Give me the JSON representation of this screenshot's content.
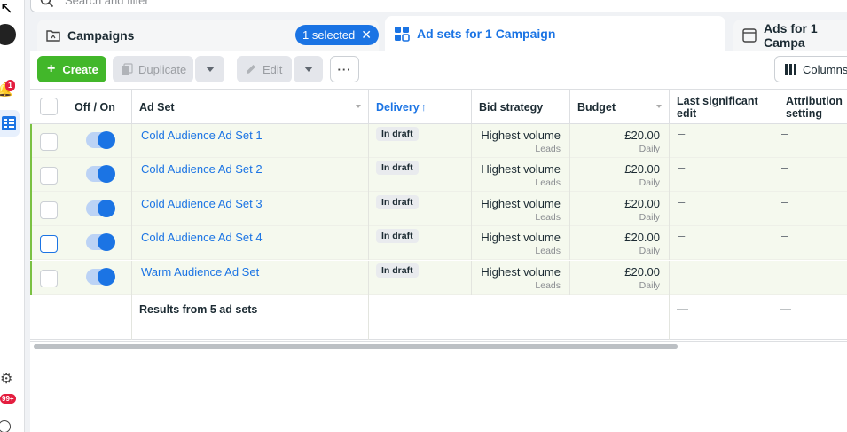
{
  "search": {
    "placeholder": "Search and filter"
  },
  "rail": {
    "notification_count": "1",
    "alerts_count": "99+"
  },
  "tabs": {
    "campaigns": {
      "label": "Campaigns",
      "selected_pill": "1 selected"
    },
    "adsets": {
      "label": "Ad sets for 1 Campaign"
    },
    "ads": {
      "label": "Ads for 1 Campa"
    }
  },
  "toolbar": {
    "create": "Create",
    "duplicate": "Duplicate",
    "edit": "Edit",
    "more": "···",
    "columns": "Columns"
  },
  "columns": {
    "off_on": "Off / On",
    "ad_set": "Ad Set",
    "delivery": "Delivery",
    "bid_strategy": "Bid strategy",
    "budget": "Budget",
    "last_edit": "Last significant edit",
    "attribution": "Attribution setting"
  },
  "rows": [
    {
      "name": "Cold Audience Ad Set 1",
      "delivery": "In draft",
      "bid": "Highest volume",
      "bid_sub": "Leads",
      "budget": "£20.00",
      "budget_sub": "Daily",
      "last_edit": "–",
      "attribution": "–",
      "on": true
    },
    {
      "name": "Cold Audience Ad Set 2",
      "delivery": "In draft",
      "bid": "Highest volume",
      "bid_sub": "Leads",
      "budget": "£20.00",
      "budget_sub": "Daily",
      "last_edit": "–",
      "attribution": "–",
      "on": true
    },
    {
      "name": "Cold Audience Ad Set 3",
      "delivery": "In draft",
      "bid": "Highest volume",
      "bid_sub": "Leads",
      "budget": "£20.00",
      "budget_sub": "Daily",
      "last_edit": "–",
      "attribution": "–",
      "on": true
    },
    {
      "name": "Cold Audience Ad Set 4",
      "delivery": "In draft",
      "bid": "Highest volume",
      "bid_sub": "Leads",
      "budget": "£20.00",
      "budget_sub": "Daily",
      "last_edit": "–",
      "attribution": "–",
      "on": true
    },
    {
      "name": "Warm Audience Ad Set",
      "delivery": "In draft",
      "bid": "Highest volume",
      "bid_sub": "Leads",
      "budget": "£20.00",
      "budget_sub": "Daily",
      "last_edit": "–",
      "attribution": "–",
      "on": true
    }
  ],
  "results": {
    "text": "Results from 5 ad sets",
    "last_edit": "—",
    "attribution": "—"
  },
  "colors": {
    "accent": "#1b74e4",
    "create_green": "#42b72a",
    "row_tint": "#f5f9ee"
  }
}
